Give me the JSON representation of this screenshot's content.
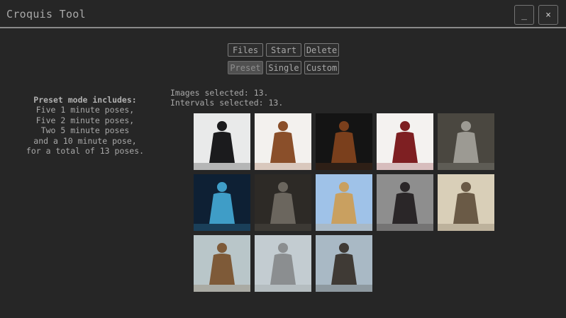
{
  "window": {
    "title": "Croquis Tool",
    "minimize_label": "_",
    "close_label": "×"
  },
  "toolbar": {
    "row1": [
      "Files",
      "Start",
      "Delete"
    ],
    "row2": [
      "Preset",
      "Single",
      "Custom"
    ],
    "active": "Preset"
  },
  "preset_info": {
    "heading": "Preset mode includes:",
    "lines": [
      "Five 1 minute poses,",
      "Five 2 minute poses,",
      "Two 5 minute poses",
      "and a 10 minute pose,",
      "for a total of 13 poses."
    ]
  },
  "status": {
    "images_selected": "Images selected: 13.",
    "intervals_selected": "Intervals selected: 13."
  },
  "thumbnails": [
    {
      "name": "hooded-figure-photo",
      "bg": "#e9eaea",
      "fg": "#1b1b1d"
    },
    {
      "name": "brown-cloak-photo",
      "bg": "#f3f1ee",
      "fg": "#8a4f2a"
    },
    {
      "name": "dark-cloak-photo",
      "bg": "#141414",
      "fg": "#7a3f1c"
    },
    {
      "name": "red-poncho-photo",
      "bg": "#f4f2f0",
      "fg": "#7e1f22"
    },
    {
      "name": "knight-armor-photo",
      "bg": "#4a4740",
      "fg": "#9c9a93"
    },
    {
      "name": "costume-stage-photo",
      "bg": "#0e2034",
      "fg": "#3f9dc7"
    },
    {
      "name": "samurai-armor-photo",
      "bg": "#2d2a26",
      "fg": "#6b665e"
    },
    {
      "name": "archer-photo",
      "bg": "#9fc2e8",
      "fg": "#c9a060"
    },
    {
      "name": "martial-artist-photo",
      "bg": "#8e8e8e",
      "fg": "#2a2628"
    },
    {
      "name": "armored-soldier-photo",
      "bg": "#d9cfb8",
      "fg": "#6a5a46"
    },
    {
      "name": "ornate-costume-photo",
      "bg": "#b9c6c9",
      "fg": "#7e5a38"
    },
    {
      "name": "helmeted-warrior-photo",
      "bg": "#c3ccd1",
      "fg": "#8b8e90"
    },
    {
      "name": "gunslinger-photo",
      "bg": "#a9b9c5",
      "fg": "#3f3a35"
    }
  ]
}
